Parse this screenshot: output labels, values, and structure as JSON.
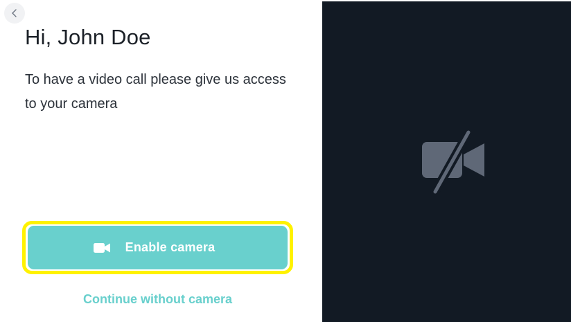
{
  "header": {
    "back_icon": "chevron-left-icon"
  },
  "main": {
    "greeting": "Hi, John Doe",
    "description": "To have a video call please give us access to your camera",
    "enable_button": {
      "label": "Enable camera",
      "icon": "video-camera-icon"
    },
    "continue_link": "Continue without camera"
  },
  "preview": {
    "icon": "video-camera-off-icon"
  },
  "colors": {
    "accent": "#69d0cd",
    "highlight": "#fff200",
    "preview_background": "#121a24",
    "preview_icon": "#5f6877",
    "text_primary": "#1c2128"
  }
}
